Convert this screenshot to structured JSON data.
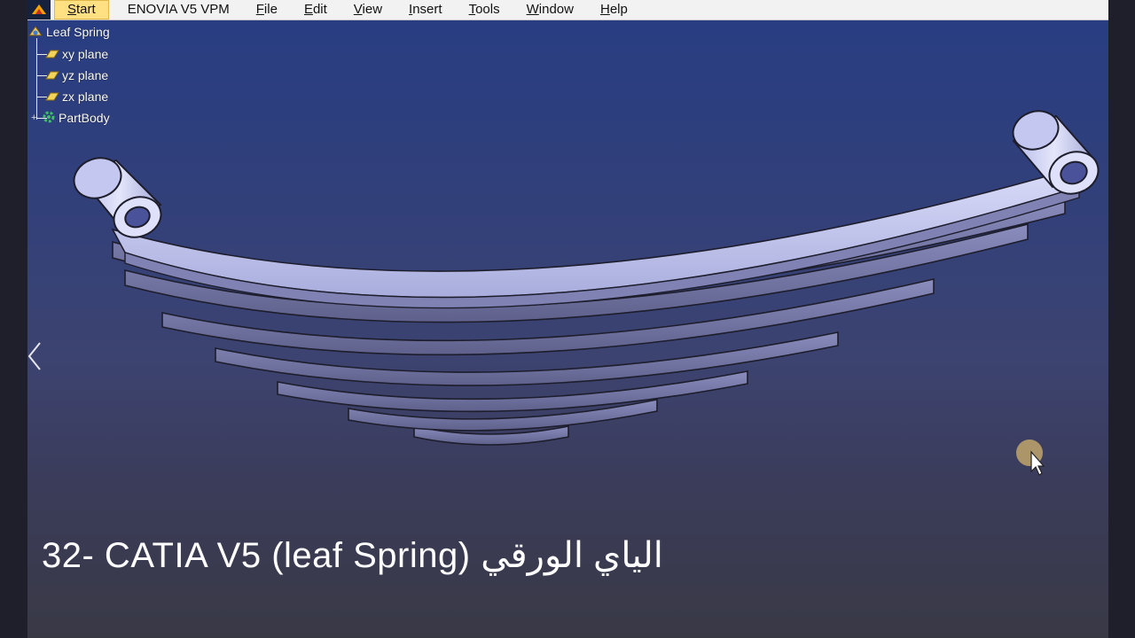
{
  "menubar": {
    "items": [
      {
        "label": "Start",
        "underline": "S",
        "rest": "tart"
      },
      {
        "label": "ENOVIA V5 VPM"
      },
      {
        "label": "File",
        "underline": "F",
        "rest": "ile"
      },
      {
        "label": "Edit",
        "underline": "E",
        "rest": "dit"
      },
      {
        "label": "View",
        "underline": "V",
        "rest": "iew"
      },
      {
        "label": "Insert",
        "underline": "I",
        "rest": "nsert"
      },
      {
        "label": "Tools",
        "underline": "T",
        "rest": "ools"
      },
      {
        "label": "Window",
        "underline": "W",
        "rest": "indow"
      },
      {
        "label": "Help",
        "underline": "H",
        "rest": "elp"
      }
    ]
  },
  "tree": {
    "root": "Leaf Spring",
    "items": [
      "xy plane",
      "yz plane",
      "zx plane",
      "PartBody"
    ]
  },
  "caption": "32- CATIA V5 (leaf Spring) الياي الورقي",
  "colors": {
    "viewport_top": "#283d82",
    "viewport_bottom": "#393946",
    "spring_light": "#c9cdf3",
    "spring_dark": "#5a5c86",
    "menu_active": "#ffe082"
  }
}
